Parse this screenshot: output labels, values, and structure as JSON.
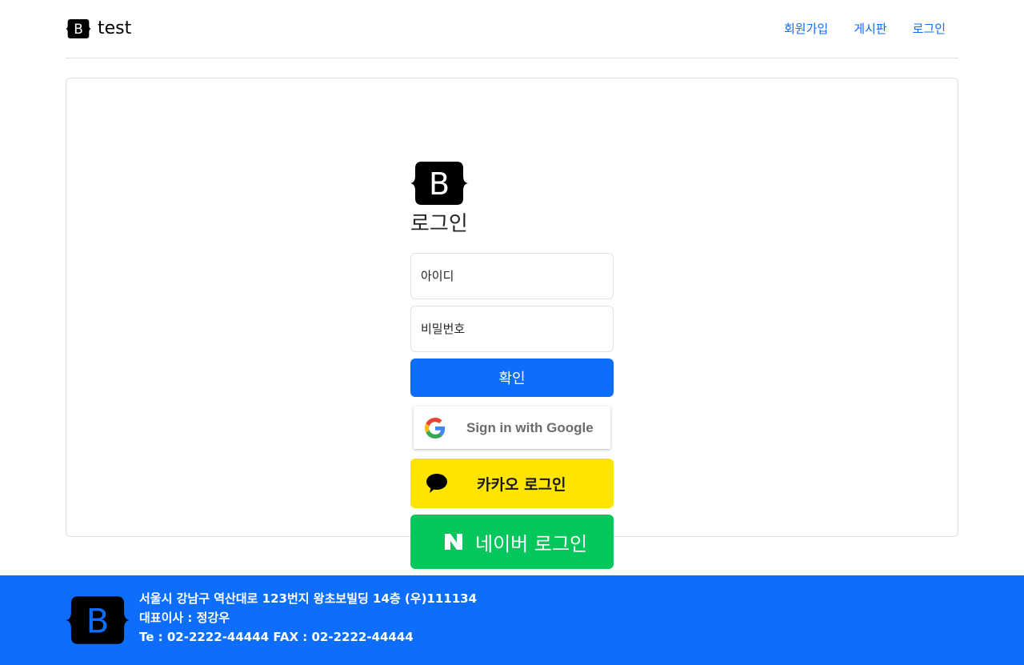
{
  "header": {
    "brand_text": "test",
    "brand_logo_icon": "bootstrap-logo-icon",
    "nav": [
      {
        "label": "회원가입"
      },
      {
        "label": "게시판"
      },
      {
        "label": "로그인"
      }
    ]
  },
  "login": {
    "logo_icon": "bootstrap-logo-icon",
    "title": "로그인",
    "id_placeholder": "아이디",
    "password_placeholder": "비밀번호",
    "submit_label": "확인",
    "google": {
      "label": "Sign in with Google",
      "icon": "google-g-icon"
    },
    "kakao": {
      "label": "카카오 로그인",
      "icon": "kakao-speech-bubble-icon",
      "color": "#fee500"
    },
    "naver": {
      "label": "네이버 로그인",
      "icon": "naver-n-icon",
      "color": "#03c75a"
    }
  },
  "footer": {
    "logo_icon": "bootstrap-logo-icon",
    "address": "서울시 강남구 역산대로 123번지 왕초보빌딩 14층 (우)111134",
    "ceo": "대표이사 : 정강우",
    "contact": "Te : 02-2222-44444 FAX : 02-2222-44444",
    "color": "#0d6efd"
  },
  "theme": {
    "primary": "#0d6efd",
    "border": "#dee2e6"
  }
}
